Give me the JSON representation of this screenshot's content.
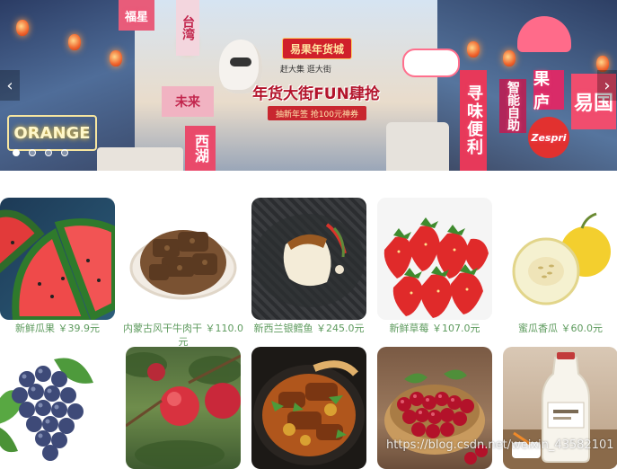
{
  "banner": {
    "signs": {
      "orange": "ORANGE",
      "xunwei": "寻味便利",
      "zhineng": "智能自助",
      "guolu": "果庐",
      "yiguo": "易国",
      "zespri": "Zespri",
      "xi": "西湖",
      "weilai": "未来",
      "top_left": "台湾",
      "top_pink": "福星"
    },
    "promo": {
      "brand": "易果年货城",
      "subtitle": "赶大集 逛大街",
      "title": "年货大街FUN肆抢",
      "coupon": "抽新年签 抢100元神券"
    },
    "prev_arrow": "‹",
    "next_arrow": "›",
    "dots": [
      true,
      false,
      false,
      false
    ]
  },
  "products": [
    {
      "name": "新鲜瓜果",
      "price": "￥39.9元",
      "label": "新鲜瓜果 ￥39.9元"
    },
    {
      "name": "内蒙古风干牛肉干",
      "price": "￥110.0元",
      "label": "内蒙古风干牛肉干 ￥110.0元"
    },
    {
      "name": "新西兰银鳕鱼",
      "price": "￥245.0元",
      "label": "新西兰银鳕鱼 ￥245.0元"
    },
    {
      "name": "新鲜草莓",
      "price": "￥107.0元",
      "label": "新鲜草莓 ￥107.0元"
    },
    {
      "name": "蜜瓜香瓜",
      "price": "￥60.0元",
      "label": "蜜瓜香瓜 ￥60.0元"
    },
    {
      "name": "葡萄",
      "price": "",
      "label": ""
    },
    {
      "name": "苹果",
      "price": "",
      "label": ""
    },
    {
      "name": "炖菜",
      "price": "",
      "label": ""
    },
    {
      "name": "樱桃",
      "price": "",
      "label": ""
    },
    {
      "name": "牛奶",
      "price": "",
      "label": ""
    }
  ],
  "watermark": "https://blog.csdn.net/weixin_43582101",
  "colors": {
    "label_green": "#5e9b5e",
    "promo_red": "#d0202b"
  }
}
